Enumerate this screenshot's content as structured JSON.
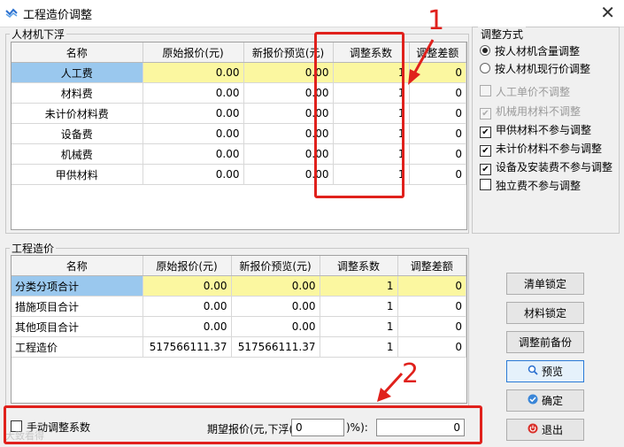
{
  "window": {
    "title": "工程造价调整",
    "close": "✕"
  },
  "material_group": {
    "legend": "人材机下浮",
    "headers": [
      "名称",
      "原始报价(元)",
      "新报价预览(元)",
      "调整系数",
      "调整差额"
    ],
    "rows": [
      [
        "人工费",
        "0.00",
        "0.00",
        "1",
        "0"
      ],
      [
        "材料费",
        "0.00",
        "0.00",
        "1",
        "0"
      ],
      [
        "未计价材料费",
        "0.00",
        "0.00",
        "1",
        "0"
      ],
      [
        "设备费",
        "0.00",
        "0.00",
        "1",
        "0"
      ],
      [
        "机械费",
        "0.00",
        "0.00",
        "1",
        "0"
      ],
      [
        "甲供材料",
        "0.00",
        "0.00",
        "1",
        "0"
      ]
    ]
  },
  "cost_group": {
    "legend": "工程造价",
    "headers": [
      "名称",
      "原始报价(元)",
      "新报价预览(元)",
      "调整系数",
      "调整差额"
    ],
    "rows": [
      [
        "分类分项合计",
        "0.00",
        "0.00",
        "1",
        "0"
      ],
      [
        "措施项目合计",
        "0.00",
        "0.00",
        "1",
        "0"
      ],
      [
        "其他项目合计",
        "0.00",
        "0.00",
        "1",
        "0"
      ],
      [
        "工程造价",
        "517566111.37",
        "517566111.37",
        "1",
        "0"
      ]
    ]
  },
  "adjust_method": {
    "legend": "调整方式",
    "radios": [
      {
        "label": "按人材机含量调整",
        "checked": true
      },
      {
        "label": "按人材机现行价调整",
        "checked": false
      }
    ],
    "checks": [
      {
        "label": "人工单价不调整",
        "checked": false,
        "disabled": true
      },
      {
        "label": "机械用材料不调整",
        "checked": true,
        "disabled": true
      },
      {
        "label": "甲供材料不参与调整",
        "checked": true,
        "disabled": false
      },
      {
        "label": "未计价材料不参与调整",
        "checked": true,
        "disabled": false
      },
      {
        "label": "设备及安装费不参与调整",
        "checked": true,
        "disabled": false
      },
      {
        "label": "独立费不参与调整",
        "checked": false,
        "disabled": false
      }
    ],
    "check_mark": "✔"
  },
  "buttons": {
    "lock_list": "清单锁定",
    "lock_material": "材料锁定",
    "backup": "调整前备份",
    "preview": "预览",
    "confirm": "确定",
    "exit": "退出"
  },
  "bottom": {
    "manual_label": "手动调整系数",
    "expect_label_pre": "期望报价(元,下浮(",
    "expect_label_post": ")%):",
    "percent_value": "0",
    "price_value": "0"
  },
  "annotations": {
    "n1": "1",
    "n2": "2"
  },
  "watermark": "大致看得",
  "colors": {
    "annotation": "#e0211c",
    "selected_name": "#9ac8ee",
    "highlight": "#fbf7a0"
  }
}
